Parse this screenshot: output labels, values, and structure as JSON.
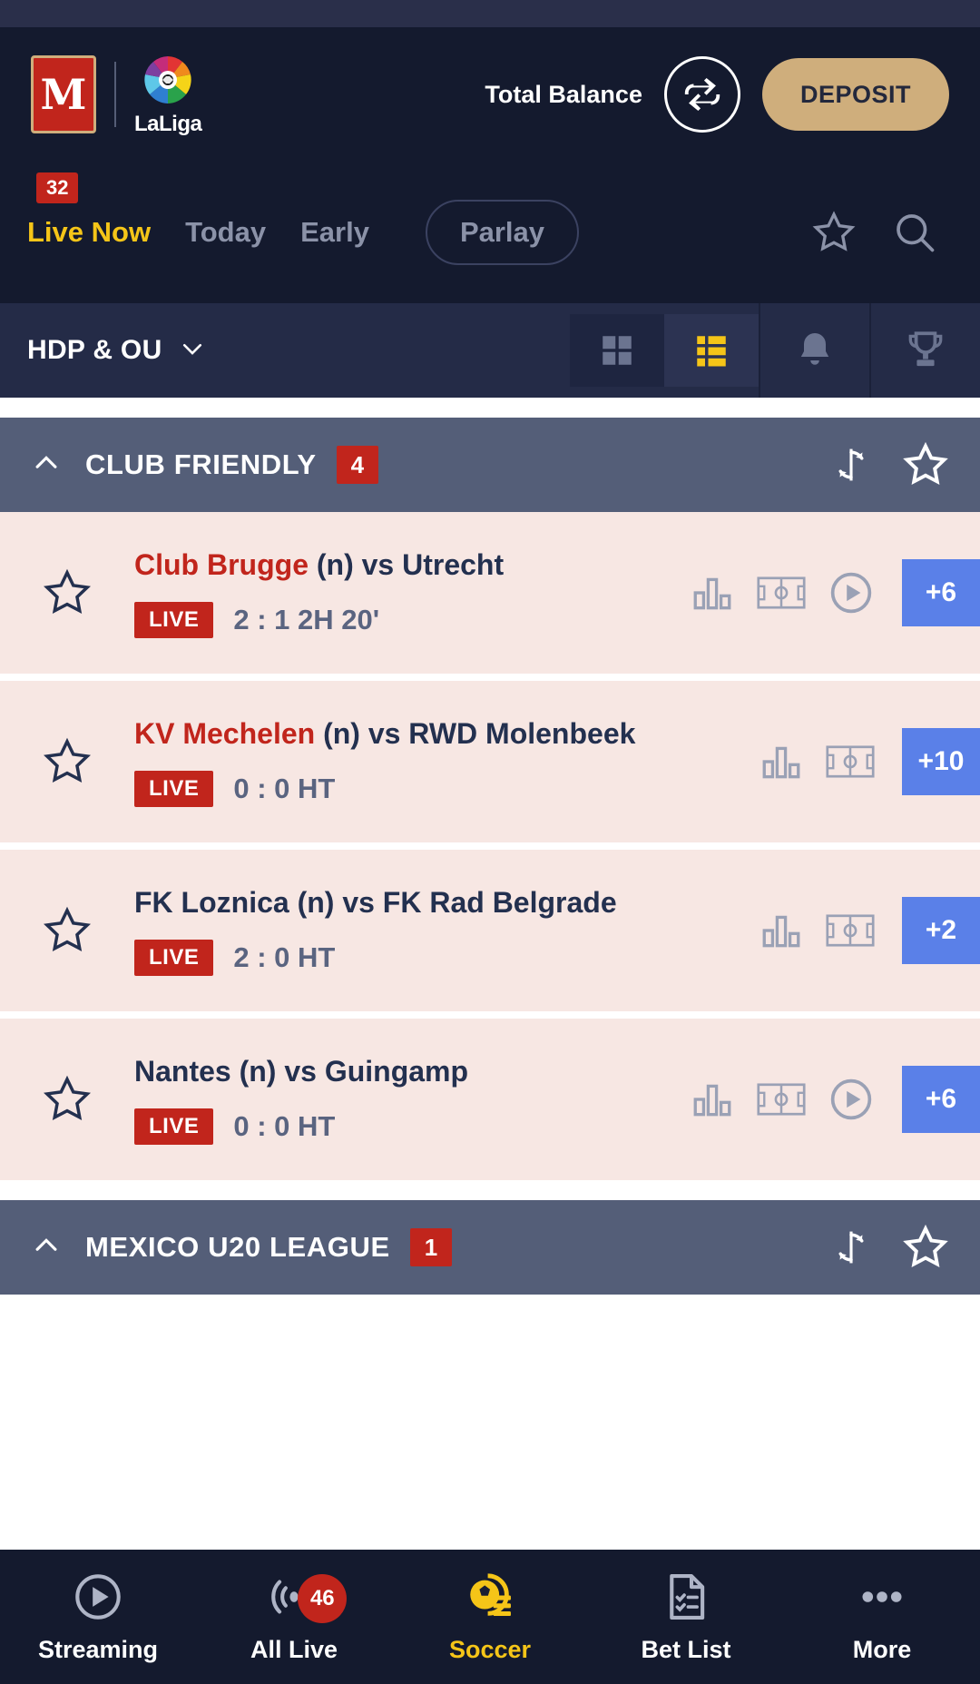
{
  "header": {
    "brand_mark": "M",
    "partner_name": "LaLiga",
    "balance_label": "Total Balance",
    "swap_icon": "swap-icon",
    "deposit_label": "DEPOSIT",
    "tabs": [
      {
        "label": "Live Now",
        "badge": "32",
        "active": true,
        "pill": false
      },
      {
        "label": "Today",
        "badge": "",
        "active": false,
        "pill": false
      },
      {
        "label": "Early",
        "badge": "",
        "active": false,
        "pill": false
      },
      {
        "label": "Parlay",
        "badge": "",
        "active": false,
        "pill": true
      }
    ],
    "favorite_icon": "star-icon",
    "search_icon": "search-icon"
  },
  "subbar": {
    "market_label": "HDP & OU",
    "dropdown_icon": "chevron-down-icon",
    "grid_view_icon": "grid-view-icon",
    "list_view_icon": "list-view-icon",
    "bell_icon": "bell-icon",
    "trophy_icon": "trophy-icon"
  },
  "leagues": [
    {
      "name": "CLUB FRIENDLY",
      "badge": "4",
      "collapse_icon": "chevron-up-icon",
      "refresh_icon": "refresh-icon",
      "star_icon": "star-icon",
      "matches": [
        {
          "home": "Club Brugge",
          "neutral": "(n)",
          "vs": "vs",
          "away": "Utrecht",
          "home_highlight": true,
          "away_highlight": false,
          "live_label": "LIVE",
          "score": "2 : 1  2H 20'",
          "odds": "+6",
          "has_stats": true,
          "has_pitch": true,
          "has_stream": true
        },
        {
          "home": "KV Mechelen",
          "neutral": "(n)",
          "vs": "vs",
          "away": "RWD Molenbeek",
          "home_highlight": true,
          "away_highlight": false,
          "live_label": "LIVE",
          "score": "0 : 0  HT",
          "odds": "+10",
          "has_stats": true,
          "has_pitch": true,
          "has_stream": false
        },
        {
          "home": "FK Loznica",
          "neutral": "(n)",
          "vs": "vs",
          "away": "FK Rad Belgrade",
          "home_highlight": false,
          "away_highlight": false,
          "live_label": "LIVE",
          "score": "2 : 0  HT",
          "odds": "+2",
          "has_stats": true,
          "has_pitch": true,
          "has_stream": false
        },
        {
          "home": "Nantes",
          "neutral": "(n)",
          "vs": "vs",
          "away": "Guingamp",
          "home_highlight": false,
          "away_highlight": false,
          "live_label": "LIVE",
          "score": "0 : 0  HT",
          "odds": "+6",
          "has_stats": true,
          "has_pitch": true,
          "has_stream": true
        }
      ]
    },
    {
      "name": "MEXICO U20 LEAGUE",
      "badge": "1",
      "collapse_icon": "chevron-up-icon",
      "refresh_icon": "refresh-icon",
      "star_icon": "star-icon",
      "matches": []
    }
  ],
  "bottom_nav": [
    {
      "label": "Streaming",
      "icon": "play-circle-icon",
      "badge": "",
      "active": false
    },
    {
      "label": "All Live",
      "icon": "broadcast-icon",
      "badge": "46",
      "active": false
    },
    {
      "label": "Soccer",
      "icon": "soccer-ball-icon",
      "badge": "",
      "active": true
    },
    {
      "label": "Bet List",
      "icon": "bet-slip-icon",
      "badge": "",
      "active": false
    },
    {
      "label": "More",
      "icon": "ellipsis-icon",
      "badge": "",
      "active": false
    }
  ],
  "colors": {
    "accent_yellow": "#f5c518",
    "brand_red": "#c1251c",
    "deposit_gold": "#cfae7c",
    "odds_blue": "#5a80e8",
    "header_navy": "#141a2e",
    "league_slate": "#545e78",
    "row_pink": "#f7e7e3"
  }
}
